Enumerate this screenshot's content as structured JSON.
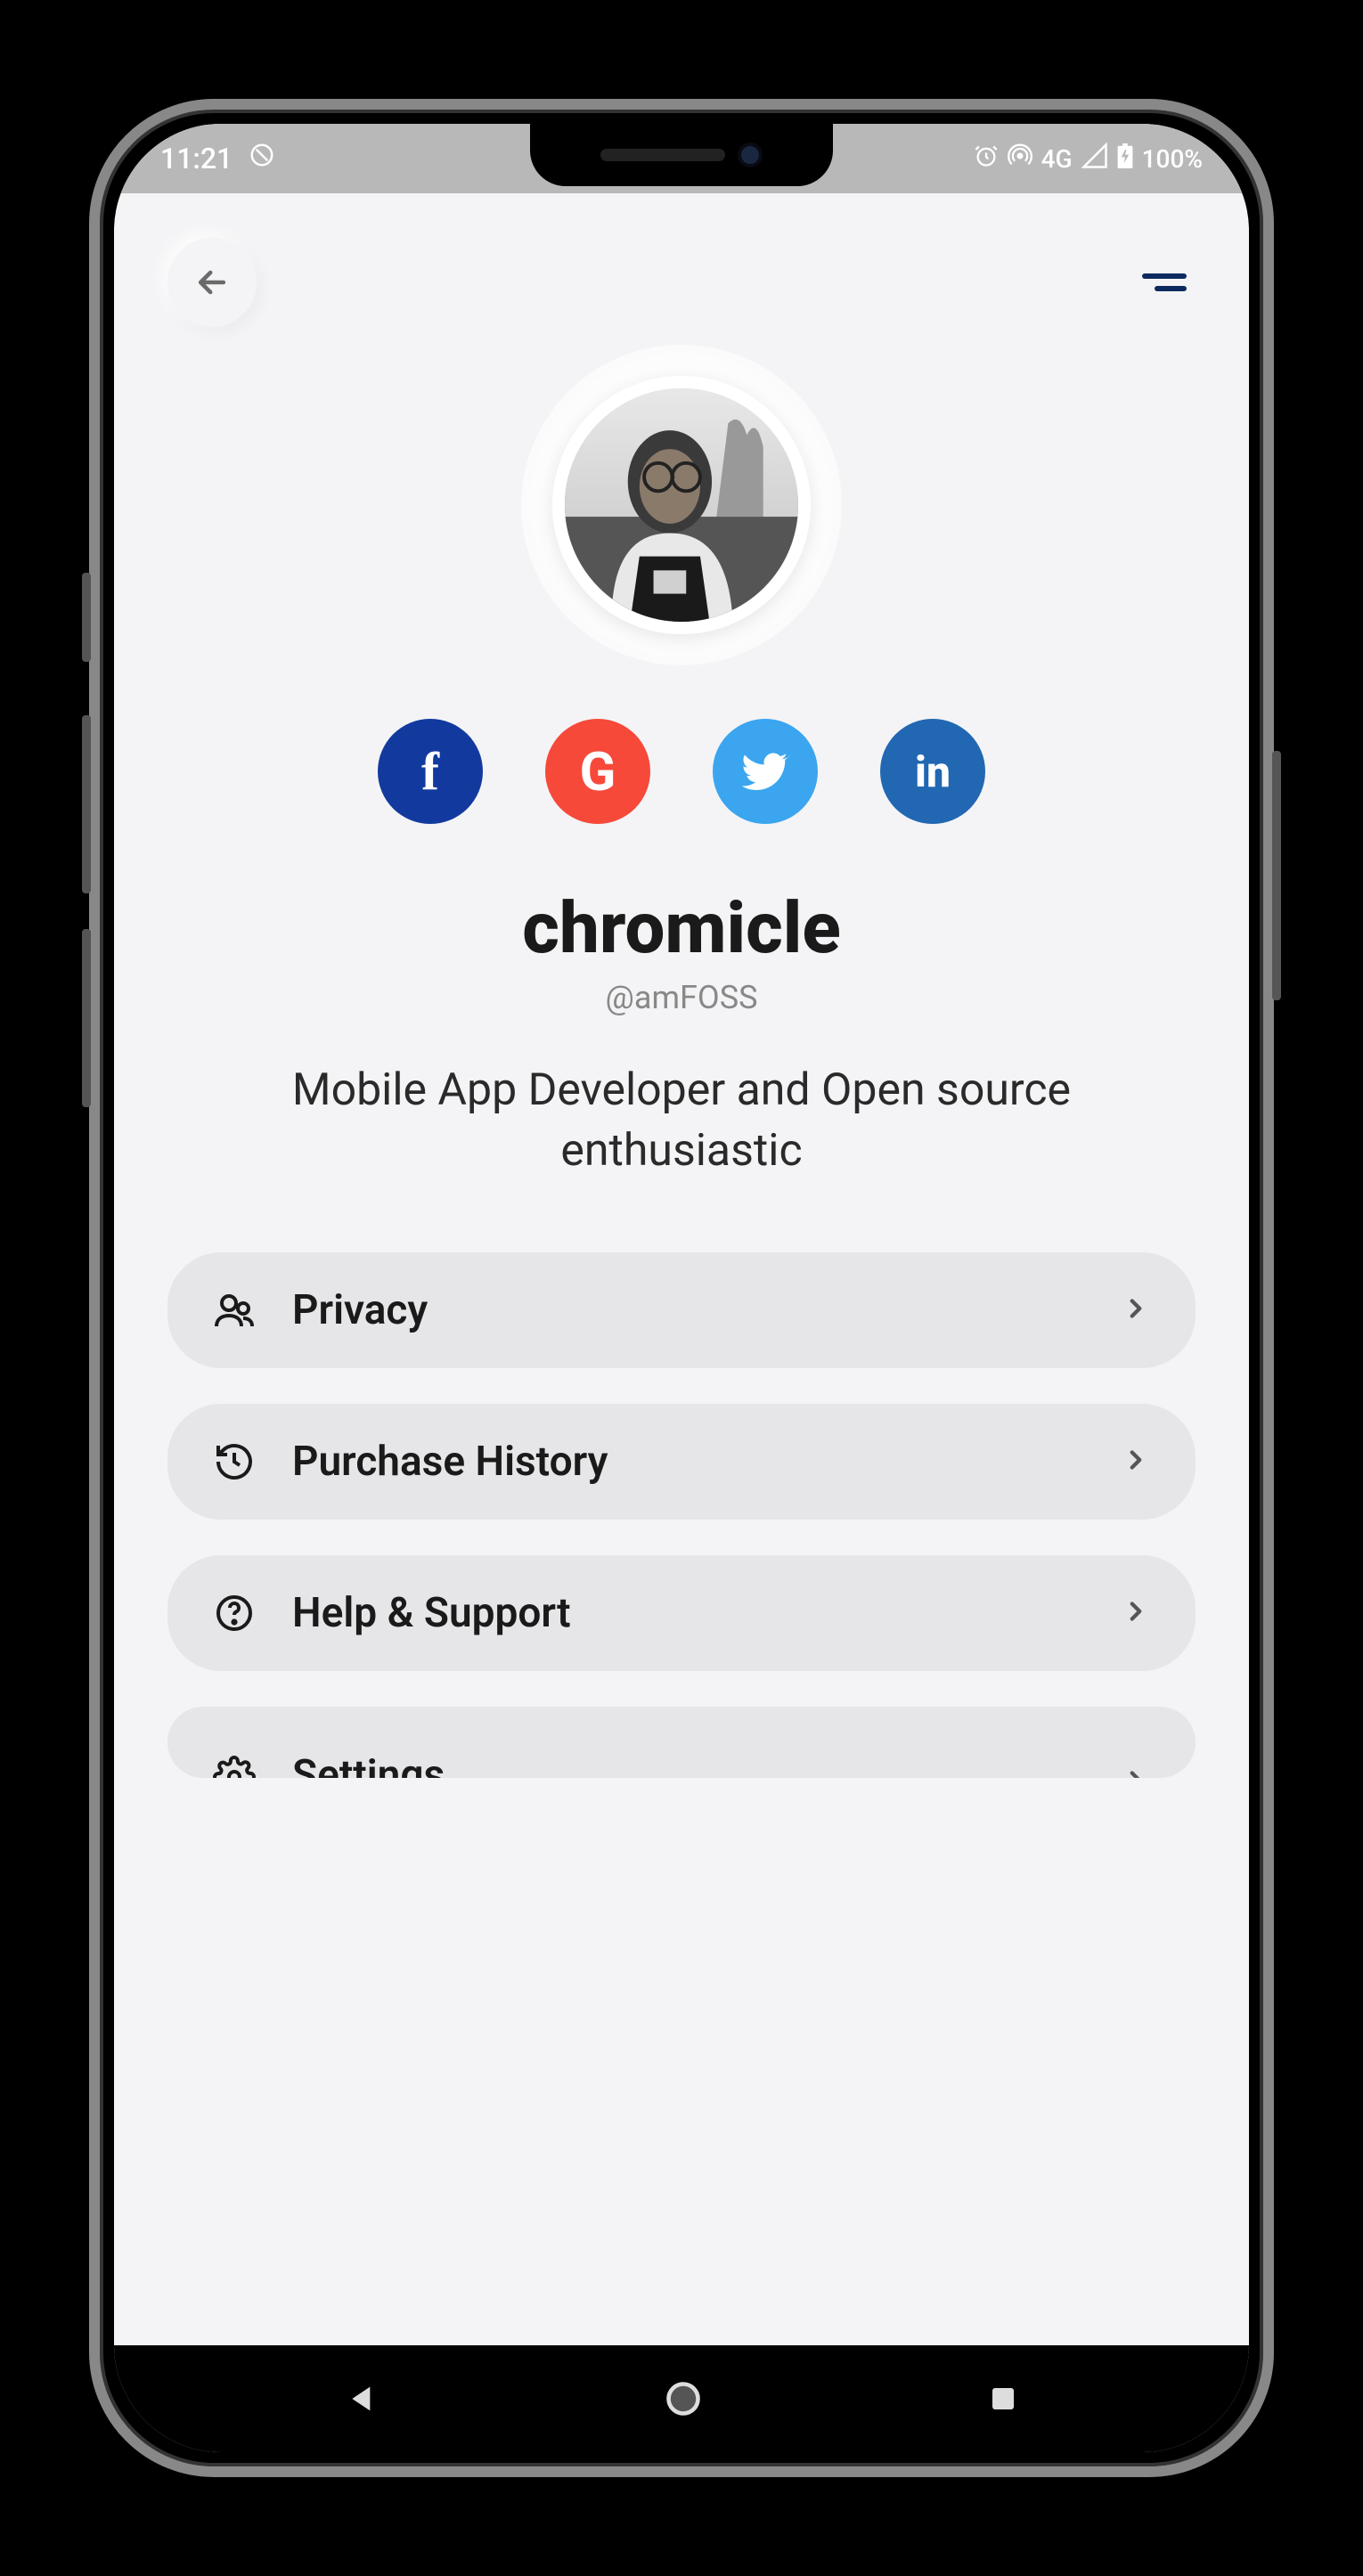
{
  "status": {
    "time": "11:21",
    "network_type": "4G",
    "battery": "100%"
  },
  "profile": {
    "name": "chromicle",
    "handle": "@amFOSS",
    "bio": "Mobile App Developer and Open source enthusiastic"
  },
  "social": {
    "facebook": "f",
    "google": "G",
    "twitter": "t",
    "linkedin": "in"
  },
  "menu": [
    {
      "icon": "people-icon",
      "label": "Privacy"
    },
    {
      "icon": "history-icon",
      "label": "Purchase History"
    },
    {
      "icon": "help-icon",
      "label": "Help & Support"
    },
    {
      "icon": "settings-icon",
      "label": "Settings"
    }
  ]
}
